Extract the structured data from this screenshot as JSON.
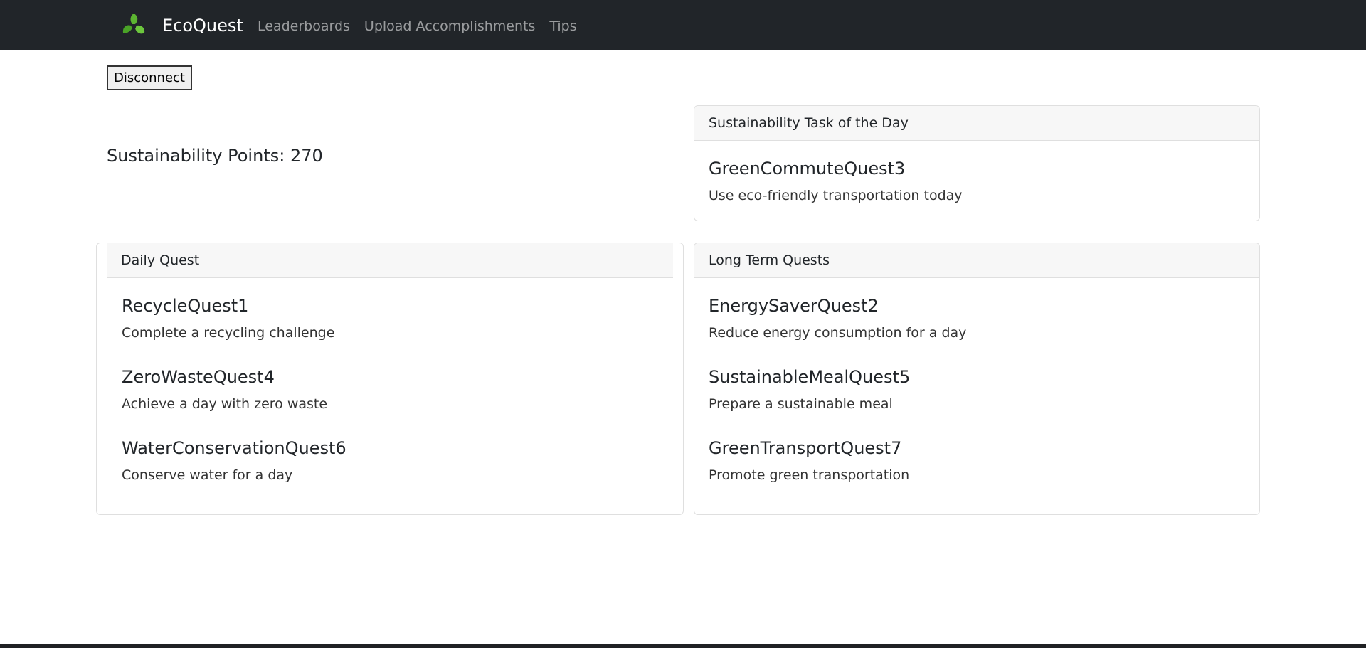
{
  "navbar": {
    "brand": "EcoQuest",
    "logo_icon": "recycle-leaves-icon",
    "links": [
      "Leaderboards",
      "Upload Accomplishments",
      "Tips"
    ]
  },
  "disconnect_label": "Disconnect",
  "points_text": "Sustainability Points: 270",
  "task_of_day": {
    "header": "Sustainability Task of the Day",
    "title": "GreenCommuteQuest3",
    "description": "Use eco-friendly transportation today"
  },
  "daily_quest": {
    "header": "Daily Quest",
    "quests": [
      {
        "title": "RecycleQuest1",
        "description": "Complete a recycling challenge"
      },
      {
        "title": "ZeroWasteQuest4",
        "description": "Achieve a day with zero waste"
      },
      {
        "title": "WaterConservationQuest6",
        "description": "Conserve water for a day"
      }
    ]
  },
  "long_term_quests": {
    "header": "Long Term Quests",
    "quests": [
      {
        "title": "EnergySaverQuest2",
        "description": "Reduce energy consumption for a day"
      },
      {
        "title": "SustainableMealQuest5",
        "description": "Prepare a sustainable meal"
      },
      {
        "title": "GreenTransportQuest7",
        "description": "Promote green transportation"
      }
    ]
  },
  "colors": {
    "navbar_bg": "#212529",
    "logo_green": "#5cb531"
  }
}
